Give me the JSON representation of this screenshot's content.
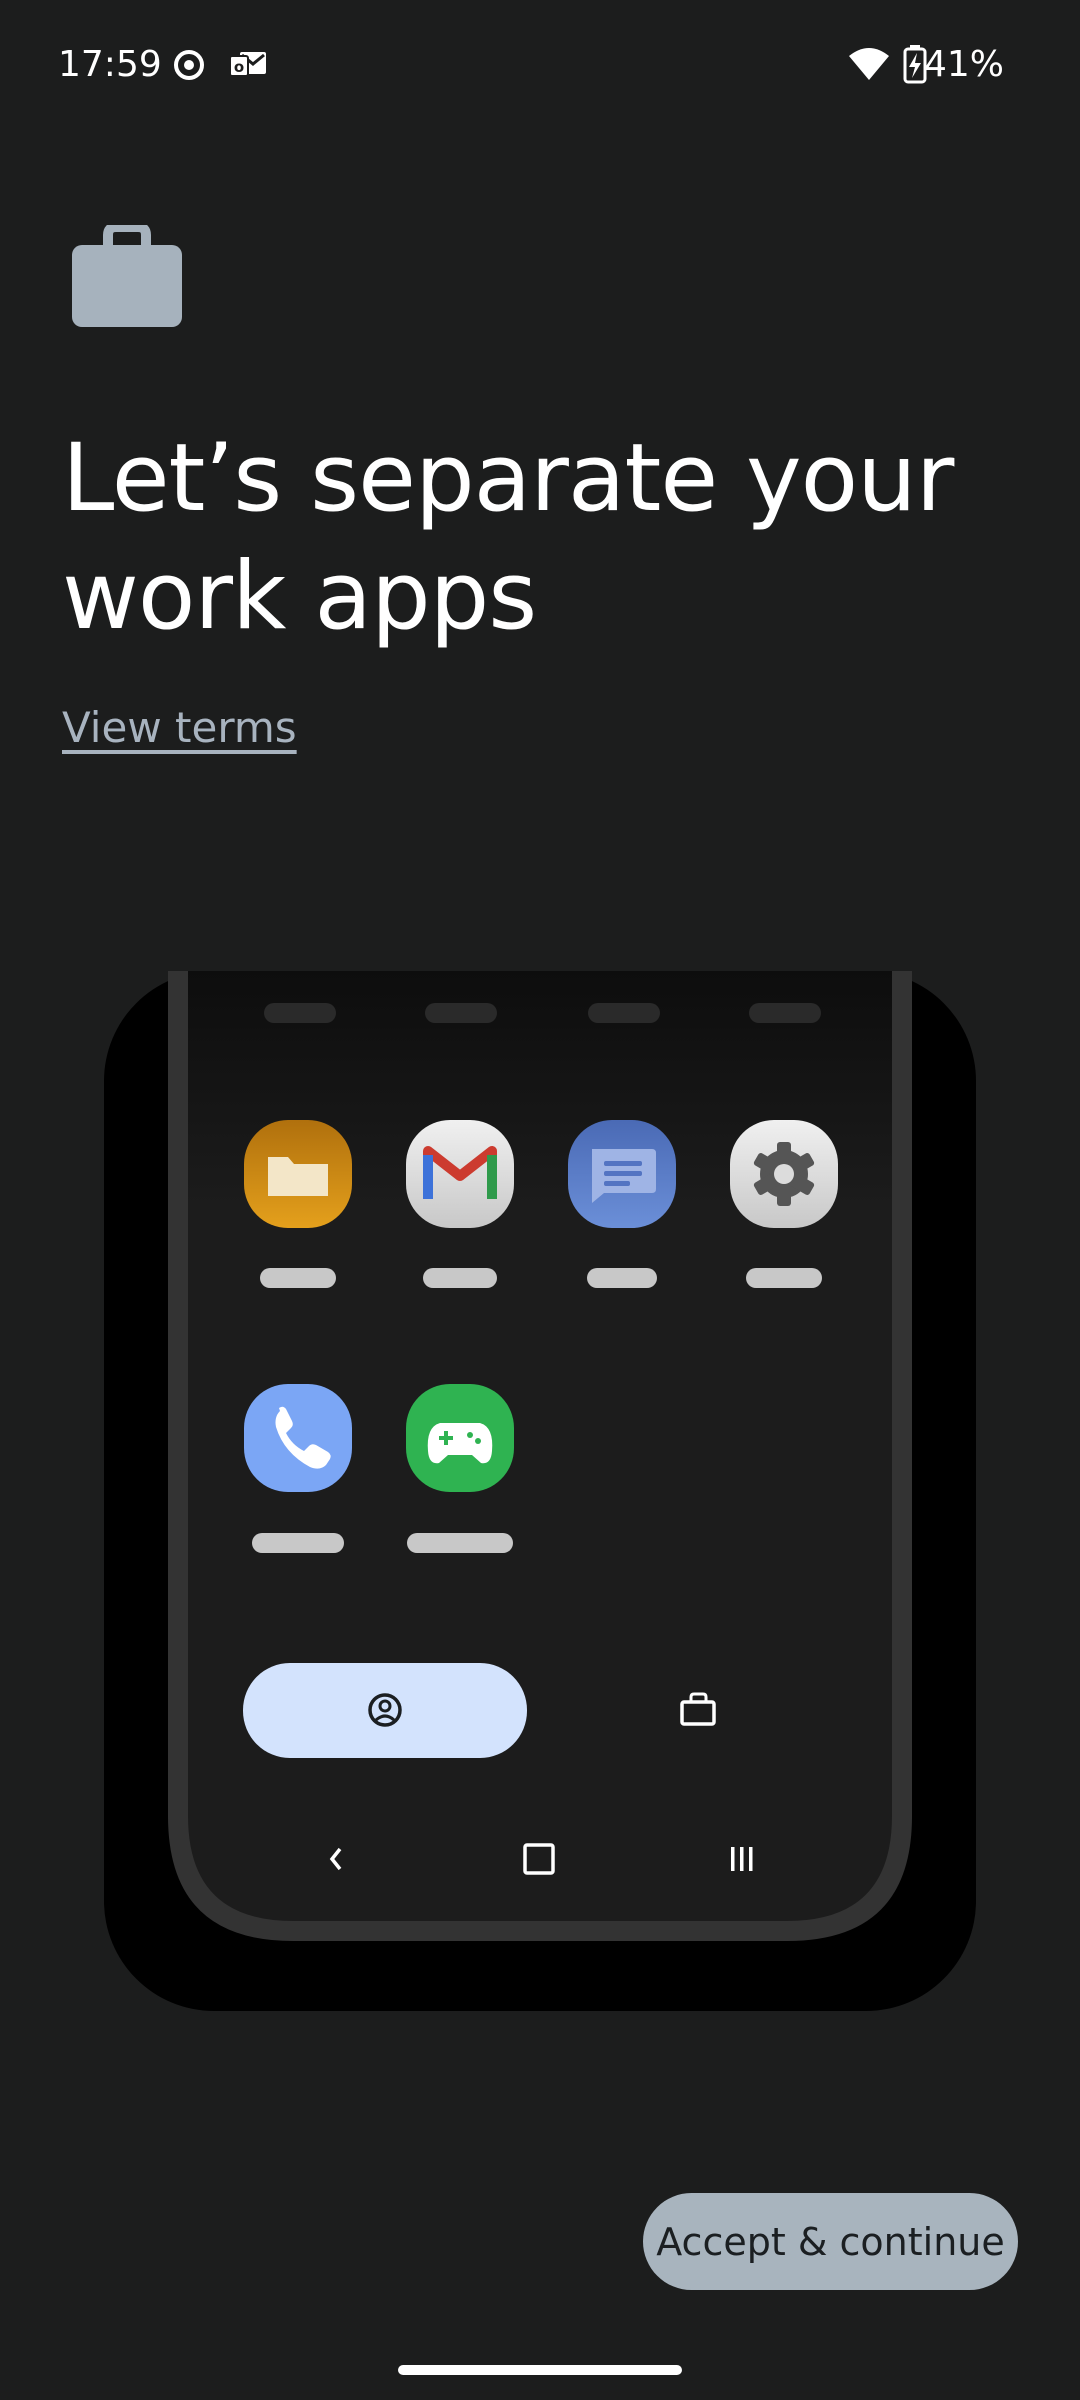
{
  "status_bar": {
    "time": "17:59",
    "battery": "41%",
    "icons": [
      "focus-mode-icon",
      "outlook-notification-icon",
      "wifi-icon",
      "battery-charging-icon"
    ]
  },
  "header": {
    "icon": "briefcase-icon",
    "title": "Let’s separate your work apps",
    "view_terms": "View terms"
  },
  "illustration": {
    "apps_row1": [
      "files-app-icon",
      "gmail-app-icon",
      "messages-app-icon",
      "settings-app-icon"
    ],
    "apps_row2": [
      "phone-app-icon",
      "games-app-icon"
    ],
    "profile_tabs": [
      "personal-profile-tab",
      "work-profile-tab"
    ],
    "nav_buttons": [
      "back-icon",
      "home-icon",
      "recents-icon"
    ]
  },
  "footer": {
    "accept_label": "Accept & continue"
  },
  "colors": {
    "background": "#1c1d1d",
    "accent": "#a8b4be",
    "link": "#a8b3bf",
    "personal_tab": "#d3e3fd"
  }
}
